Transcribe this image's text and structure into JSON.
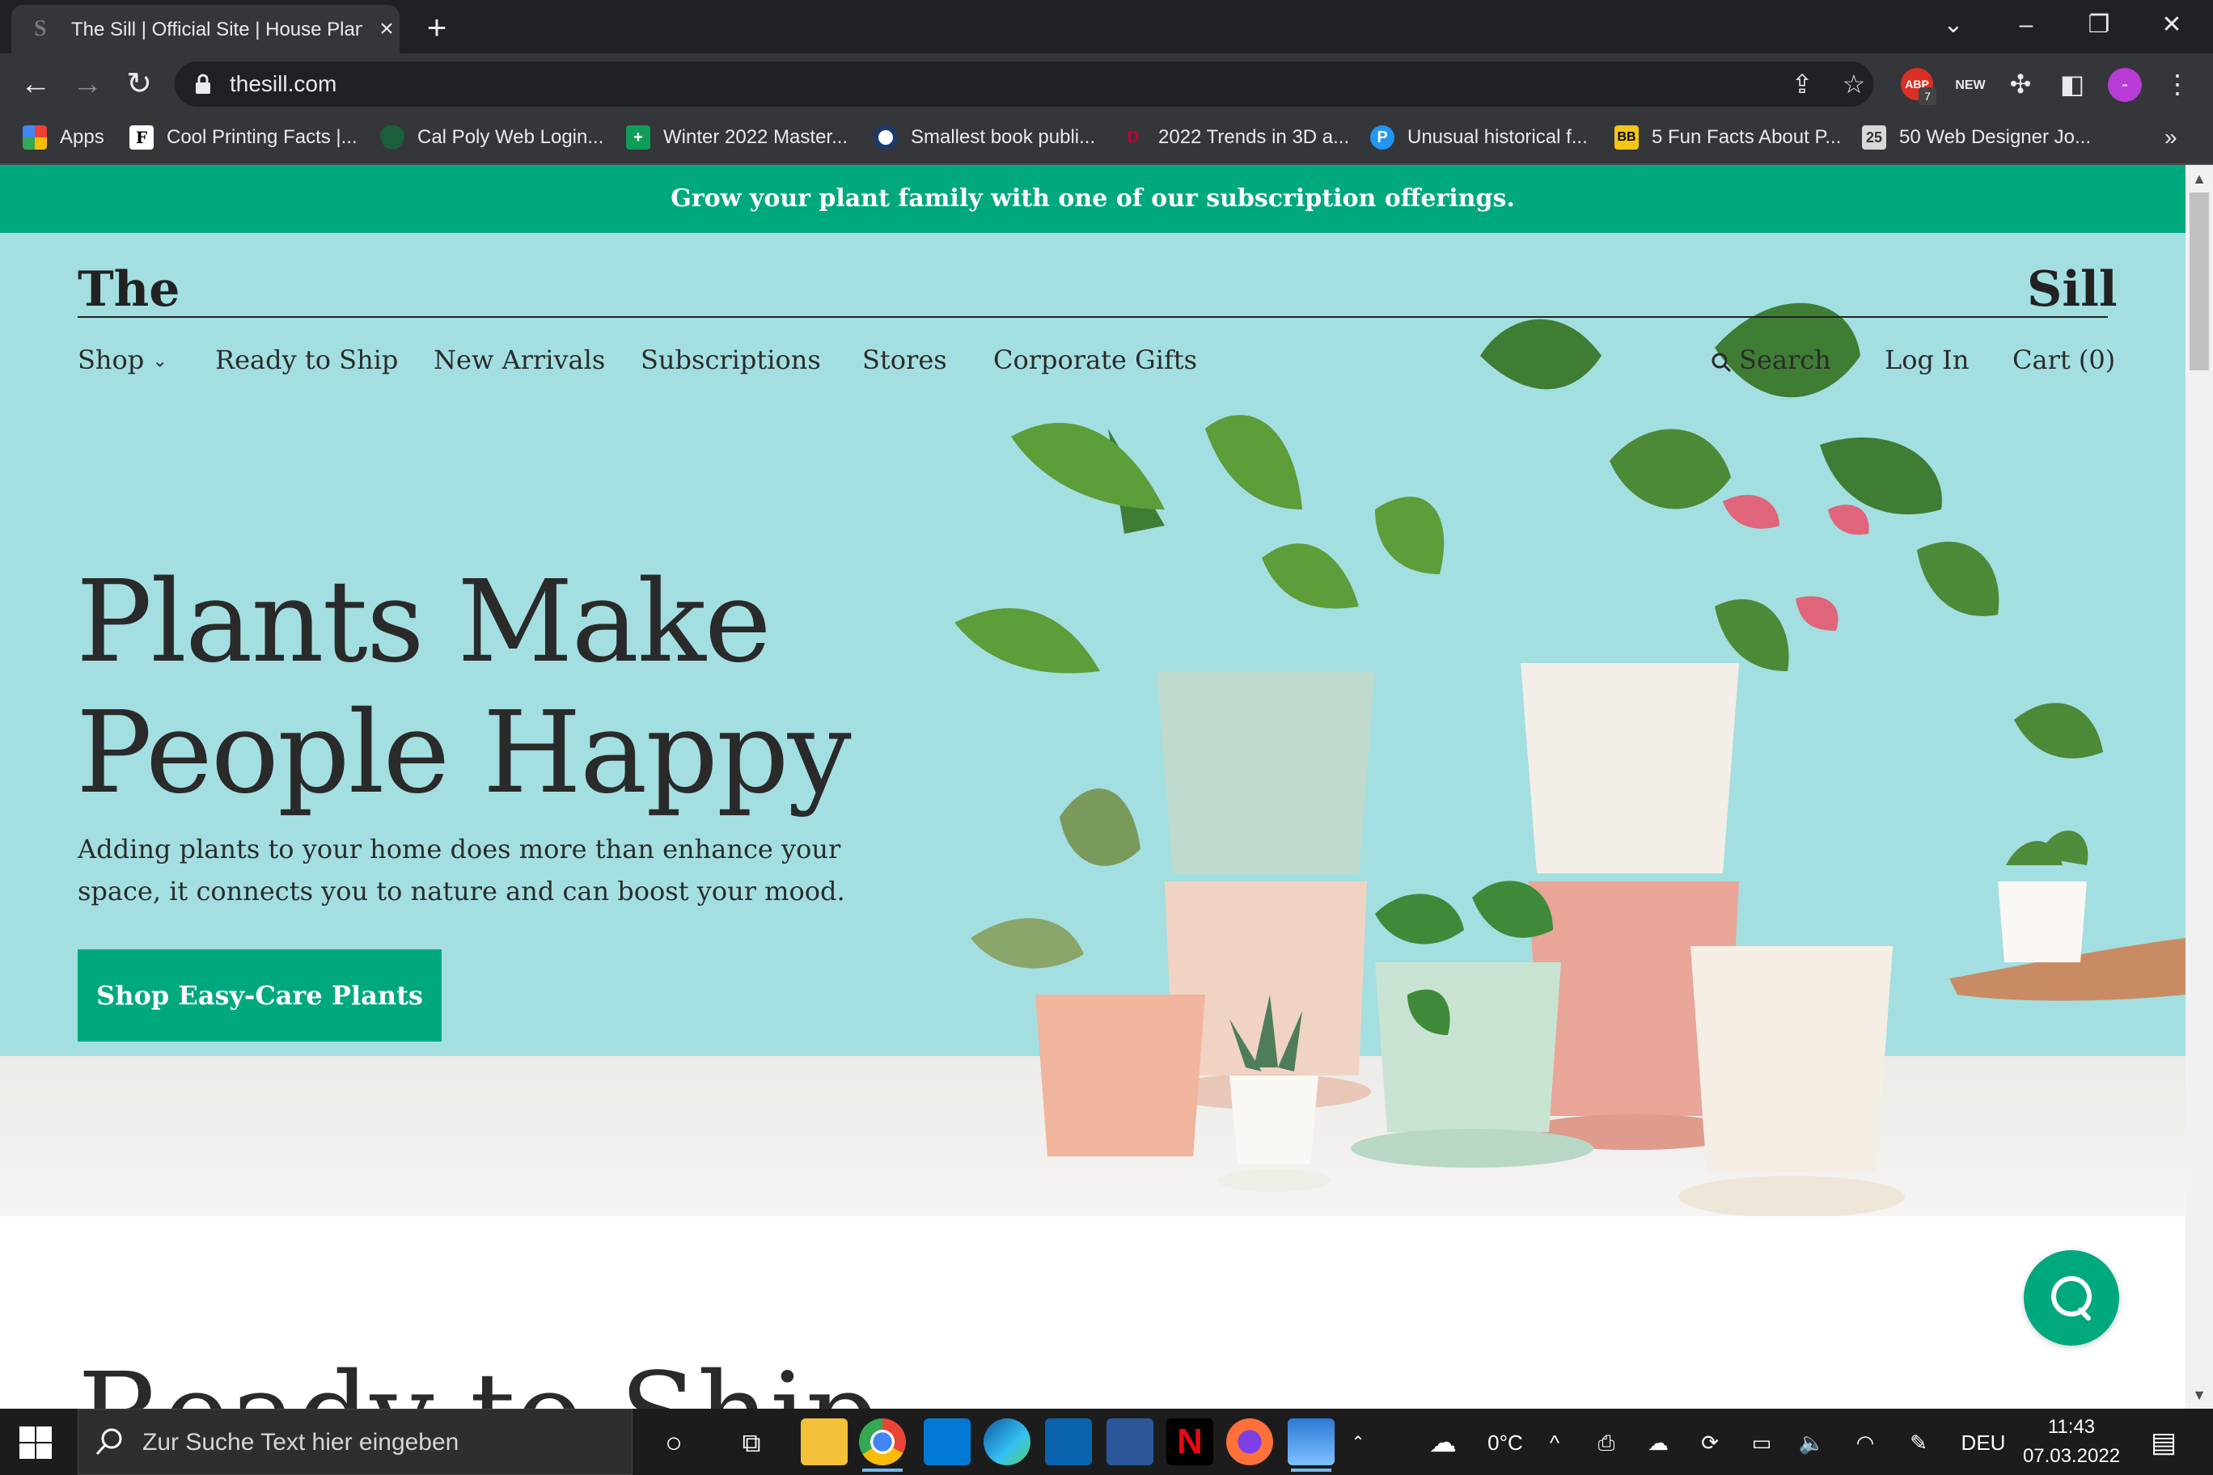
{
  "browser": {
    "tab_title": "The Sill | Official Site | House Plants",
    "tab_favicon": "S",
    "new_tab_glyph": "+",
    "url": "thesill.com",
    "bookmarks": [
      {
        "label": "Apps",
        "icon": "apps-grid-icon"
      },
      {
        "label": "Cool Printing Facts |...",
        "icon": "F"
      },
      {
        "label": "Cal Poly Web Login...",
        "icon": "shield"
      },
      {
        "label": "Winter 2022 Master...",
        "icon": "+"
      },
      {
        "label": "Smallest book publi...",
        "icon": "record-icon"
      },
      {
        "label": "2022 Trends in 3D a...",
        "icon": "D"
      },
      {
        "label": "Unusual historical f...",
        "icon": "P"
      },
      {
        "label": "5 Fun Facts About P...",
        "icon": "BB"
      },
      {
        "label": "50 Web Designer Jo...",
        "icon": "25"
      }
    ],
    "bookmarks_overflow": "»",
    "extension_badge": "7",
    "extension_new": "NEW",
    "profile_initial": "-"
  },
  "site": {
    "promo": "Grow your plant family with one of our subscription offerings.",
    "brand_left": "The",
    "brand_right": "Sill",
    "nav": [
      "Shop",
      "Ready to Ship",
      "New Arrivals",
      "Subscriptions",
      "Stores",
      "Corporate Gifts"
    ],
    "nav_right": {
      "search": "Search",
      "login": "Log In",
      "cart": "Cart (0)"
    },
    "headline_line1": "Plants Make",
    "headline_line2": "People Happy",
    "subcopy": "Adding plants to your home does more than enhance your space, it connects you to nature and can boost your mood.",
    "cta": "Shop Easy-Care Plants",
    "section_title": "Ready to Ship"
  },
  "taskbar": {
    "search_placeholder": "Zur Suche Text hier eingeben",
    "weather": "0°C",
    "language": "DEU",
    "time": "11:43",
    "date": "07.03.2022"
  },
  "colors": {
    "brand_green": "#00a87e",
    "hero_background": "#a3dfe1",
    "text_dark": "#2a2a2a"
  }
}
